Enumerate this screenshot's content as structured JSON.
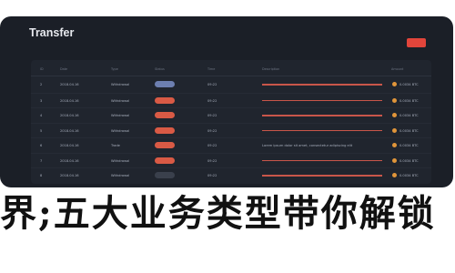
{
  "window": {
    "title": "Transfer"
  },
  "table": {
    "headers": [
      "ID",
      "Date",
      "Type",
      "Status",
      "Time",
      "Description",
      "Amount"
    ],
    "rows": [
      {
        "id": "2",
        "date": "2018.04.16",
        "type": "Withdrawal",
        "status_color": "blue",
        "time": "09:22",
        "desc": "",
        "amount": "0.0034 BTC"
      },
      {
        "id": "3",
        "date": "2018.04.16",
        "type": "Withdrawal",
        "status_color": "red",
        "time": "09:22",
        "desc": "",
        "amount": "0.0034 BTC"
      },
      {
        "id": "4",
        "date": "2018.04.16",
        "type": "Withdrawal",
        "status_color": "red",
        "time": "09:22",
        "desc": "",
        "amount": "0.0034 BTC"
      },
      {
        "id": "5",
        "date": "2018.04.16",
        "type": "Withdrawal",
        "status_color": "red",
        "time": "09:22",
        "desc": "",
        "amount": "0.0034 BTC"
      },
      {
        "id": "6",
        "date": "2018.04.16",
        "type": "Trade",
        "status_color": "red",
        "time": "09:22",
        "desc": "Lorem ipsum dolor sit amet, consectetur adipiscing elit",
        "amount": "0.0034 BTC"
      },
      {
        "id": "7",
        "date": "2018.04.16",
        "type": "Withdrawal",
        "status_color": "red",
        "time": "09:22",
        "desc": "",
        "amount": "0.0034 BTC"
      },
      {
        "id": "8",
        "date": "2018.04.16",
        "type": "Withdrawal",
        "status_color": "gray",
        "time": "09:22",
        "desc": "",
        "amount": "0.0034 BTC"
      }
    ]
  },
  "banner": {
    "text": "界;五大业务类型带你解锁"
  },
  "colors": {
    "window_bg": "#1b1f27",
    "accent": "#e2453b",
    "coin": "#e0953a"
  }
}
